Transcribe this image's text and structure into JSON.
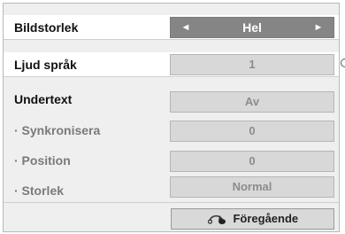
{
  "menu": {
    "items": [
      {
        "label": "Bildstorlek",
        "value": "Hel",
        "active": true
      },
      {
        "label": "Ljud språk",
        "value": "1"
      },
      {
        "label": "Undertext",
        "value": "Av"
      },
      {
        "label": "· Synkronisera",
        "value": "0"
      },
      {
        "label": "· Position",
        "value": "0"
      },
      {
        "label": "· Storlek",
        "value": "Normal"
      }
    ],
    "back_label": "Föregående",
    "back_icon": "return-arrow-icon",
    "left_arrow": "◄",
    "right_arrow": "►"
  },
  "colors": {
    "panel_bg": "#efefef",
    "active_value_bg": "#858585",
    "value_bg": "#d8d8d8"
  }
}
